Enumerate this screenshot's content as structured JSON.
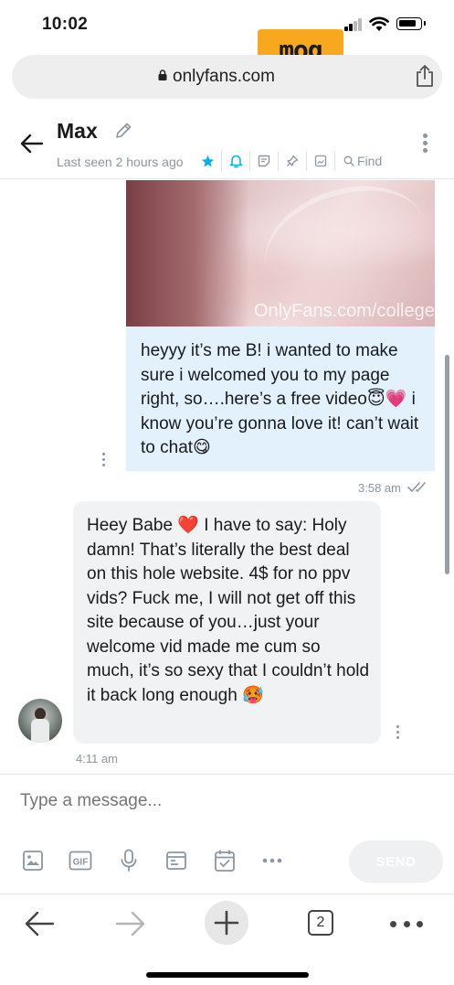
{
  "status_bar": {
    "time": "10:02"
  },
  "watermark": {
    "text": "moq"
  },
  "browser": {
    "url": "onlyfans.com",
    "tab_count": "2"
  },
  "chat_header": {
    "name": "Max",
    "last_seen": "Last seen 2 hours ago",
    "find_label": "Find"
  },
  "messages": [
    {
      "direction": "outgoing",
      "media_watermark": "OnlyFans.com/collegegirlfriend",
      "text": "heyyy it’s me B! i wanted to make sure i welcomed you to my page right, so….here’s a free video😇💗 i know you’re gonna love it! can’t wait to chat😋",
      "time": "3:58 am"
    },
    {
      "direction": "incoming",
      "text": "Heey Babe ❤️ I have to say: Holy damn! That’s literally the best deal on this hole website. 4$ for no ppv vids? Fuck me, I will not get off this site because of you…just your welcome vid made me cum so much, it’s so sexy that I couldn’t hold it back long enough 🥵",
      "time": "4:11 am"
    }
  ],
  "composer": {
    "placeholder": "Type a message...",
    "send_label": "SEND",
    "gif_label": "GIF"
  },
  "colors": {
    "accent": "#00aff0",
    "outgoing_bubble": "#e2f1fb",
    "incoming_bubble": "#f1f2f3",
    "muted_text": "#8a96a3"
  }
}
